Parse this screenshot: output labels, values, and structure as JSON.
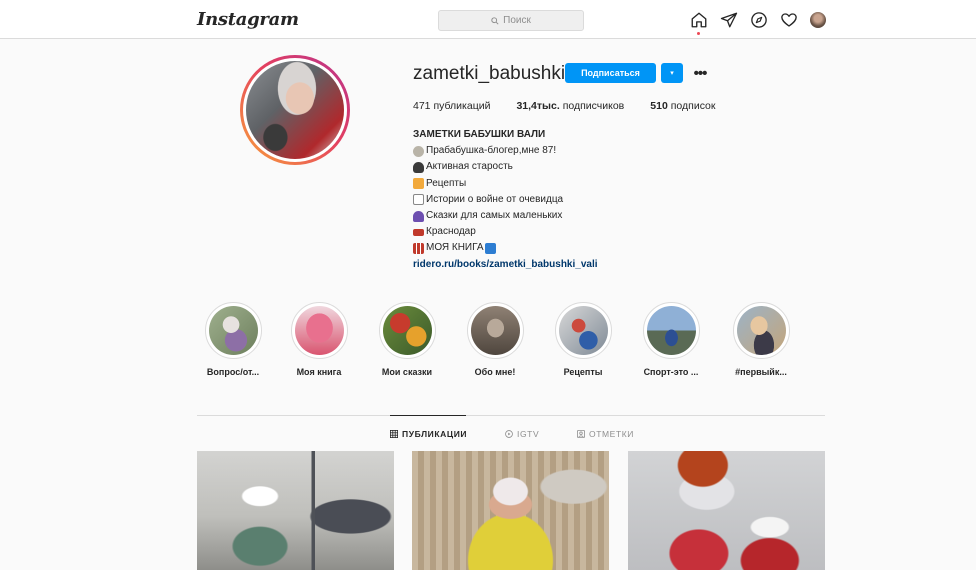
{
  "app": {
    "logo": "Instagram"
  },
  "search": {
    "placeholder": "Поиск"
  },
  "nav": {
    "icons": [
      "home-icon",
      "direct-icon",
      "explore-icon",
      "activity-heart-icon",
      "profile-avatar"
    ]
  },
  "profile": {
    "username": "zametki_babushki",
    "follow_label": "Подписаться",
    "dropdown_glyph": "▾",
    "more_glyph": "•••",
    "stats": {
      "posts_value": "471",
      "posts_label": "публикаций",
      "followers_value": "31,4тыс.",
      "followers_label": "подписчиков",
      "following_value": "510",
      "following_label": "подписок"
    },
    "bio": {
      "name": "ЗАМЕТКИ БАБУШКИ ВАЛИ",
      "lines": [
        "Прабабушка-блогер,мне 87!",
        "Активная старость",
        "Рецепты",
        " Истории о войне от очевидца",
        " Сказки для самых маленьких",
        " Краснодар",
        "МОЯ КНИГА"
      ],
      "link": "ridero.ru/books/zametki_babushki_vali"
    }
  },
  "highlights": [
    {
      "label": "Вопрос/от..."
    },
    {
      "label": "Моя книга"
    },
    {
      "label": "Мои сказки"
    },
    {
      "label": "Обо мне!"
    },
    {
      "label": "Рецепты"
    },
    {
      "label": "Спорт-это ..."
    },
    {
      "label": "#первыйк..."
    }
  ],
  "tabs": [
    {
      "label": "ПУБЛИКАЦИИ",
      "active": true
    },
    {
      "label": "IGTV",
      "active": false
    },
    {
      "label": "ОТМЕТКИ",
      "active": false
    }
  ],
  "colors": {
    "accent": "#0095f6",
    "link": "#00376b",
    "notification": "#ed4956"
  }
}
